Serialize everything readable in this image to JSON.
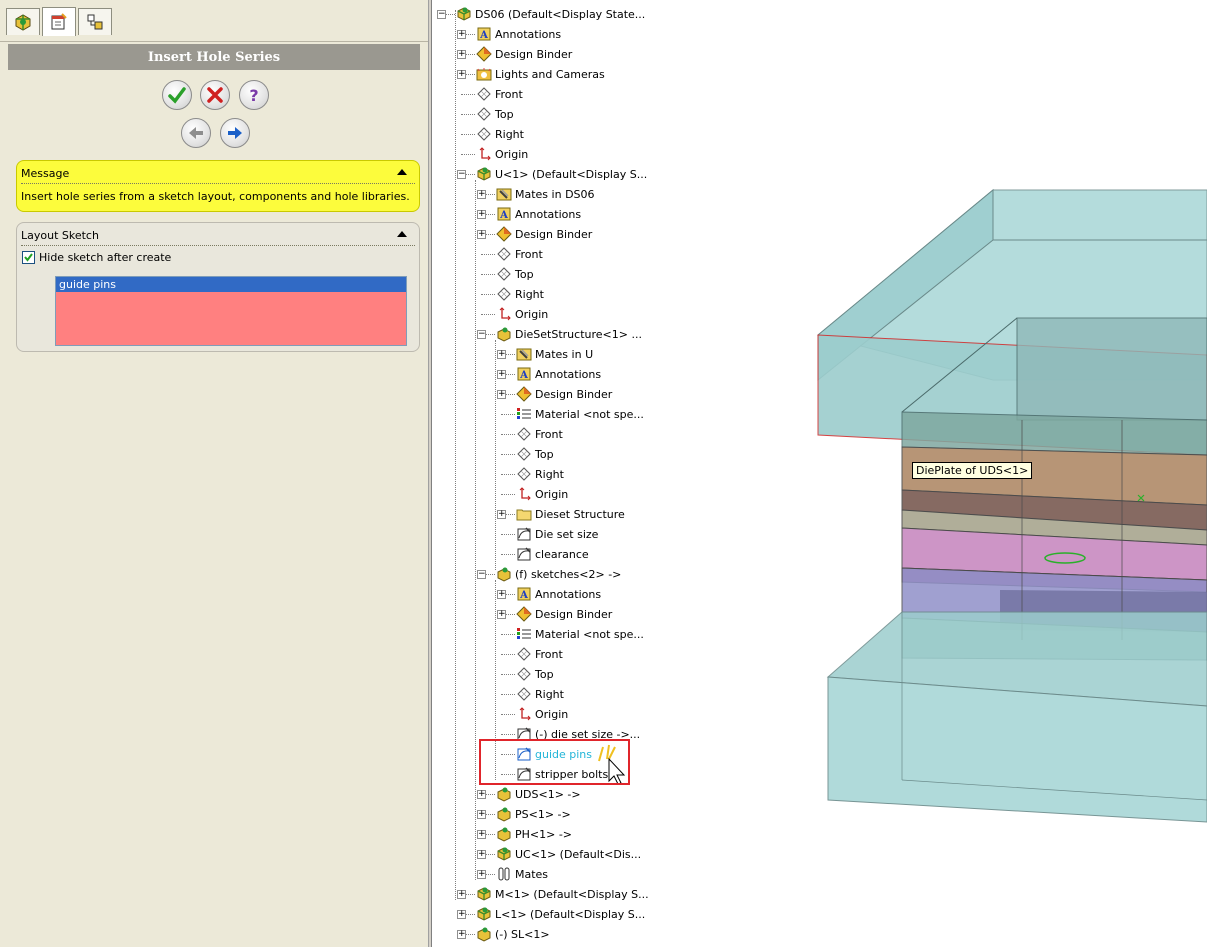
{
  "property_manager": {
    "tabs": [
      "feature-manager-tab",
      "property-manager-tab",
      "configuration-manager-tab"
    ],
    "title": "Insert Hole Series",
    "buttons": [
      "ok",
      "cancel",
      "help",
      "back",
      "next"
    ],
    "message": {
      "title": "Message",
      "text": "Insert hole series from a sketch layout, components and hole libraries."
    },
    "layout_sketch": {
      "title": "Layout Sketch",
      "hide_sketch_label": "Hide sketch after create",
      "hide_sketch_checked": true,
      "selected_sketch": "guide pins"
    }
  },
  "tree": {
    "items": [
      {
        "label": "DS06  (Default<Display State...",
        "icon": "assembly-icon"
      },
      {
        "label": "Annotations",
        "icon": "annotations-icon"
      },
      {
        "label": "Design Binder",
        "icon": "design-binder-icon"
      },
      {
        "label": "Lights and Cameras",
        "icon": "lights-icon"
      },
      {
        "label": "Front",
        "icon": "plane-icon"
      },
      {
        "label": "Top",
        "icon": "plane-icon"
      },
      {
        "label": "Right",
        "icon": "plane-icon"
      },
      {
        "label": "Origin",
        "icon": "origin-icon"
      },
      {
        "label": "U<1> (Default<Display S...",
        "icon": "assembly-icon"
      },
      {
        "label": "Mates in DS06",
        "icon": "mates-folder-icon"
      },
      {
        "label": "Annotations",
        "icon": "annotations-icon"
      },
      {
        "label": "Design Binder",
        "icon": "design-binder-icon"
      },
      {
        "label": "Front",
        "icon": "plane-icon"
      },
      {
        "label": "Top",
        "icon": "plane-icon"
      },
      {
        "label": "Right",
        "icon": "plane-icon"
      },
      {
        "label": "Origin",
        "icon": "origin-icon"
      },
      {
        "label": "DieSetStructure<1> ...",
        "icon": "part-assembly-icon"
      },
      {
        "label": "Mates in U",
        "icon": "mates-folder-icon"
      },
      {
        "label": "Annotations",
        "icon": "annotations-icon"
      },
      {
        "label": "Design Binder",
        "icon": "design-binder-icon"
      },
      {
        "label": "Material <not spe...",
        "icon": "material-icon"
      },
      {
        "label": "Front",
        "icon": "plane-icon"
      },
      {
        "label": "Top",
        "icon": "plane-icon"
      },
      {
        "label": "Right",
        "icon": "plane-icon"
      },
      {
        "label": "Origin",
        "icon": "origin-icon"
      },
      {
        "label": "Dieset Structure",
        "icon": "folder-icon"
      },
      {
        "label": "Die  set size",
        "icon": "sketch-icon"
      },
      {
        "label": "clearance",
        "icon": "sketch-icon"
      },
      {
        "label": "(f) sketches<2> ->",
        "icon": "part-assembly-icon"
      },
      {
        "label": "Annotations",
        "icon": "annotations-icon"
      },
      {
        "label": "Design Binder",
        "icon": "design-binder-icon"
      },
      {
        "label": "Material <not spe...",
        "icon": "material-icon"
      },
      {
        "label": "Front",
        "icon": "plane-icon"
      },
      {
        "label": "Top",
        "icon": "plane-icon"
      },
      {
        "label": "Right",
        "icon": "plane-icon"
      },
      {
        "label": "Origin",
        "icon": "origin-icon"
      },
      {
        "label": "(-) die set size ->...",
        "icon": "sketch-icon"
      },
      {
        "label": "guide pins",
        "icon": "sketch-selected-icon"
      },
      {
        "label": "stripper bolts",
        "icon": "sketch-icon"
      },
      {
        "label": "UDS<1> ->",
        "icon": "part-assembly-icon"
      },
      {
        "label": "PS<1> ->",
        "icon": "part-assembly-icon"
      },
      {
        "label": "PH<1> ->",
        "icon": "part-assembly-icon"
      },
      {
        "label": "UC<1> (Default<Dis...",
        "icon": "assembly-icon"
      },
      {
        "label": "Mates",
        "icon": "mates-icon"
      },
      {
        "label": "M<1> (Default<Display S...",
        "icon": "assembly-icon"
      },
      {
        "label": "L<1> (Default<Display S...",
        "icon": "assembly-icon"
      },
      {
        "label": "(-) SL<1>",
        "icon": "part-assembly-icon"
      }
    ]
  },
  "graphics": {
    "tooltip": "DiePlate of UDS<1>"
  }
}
